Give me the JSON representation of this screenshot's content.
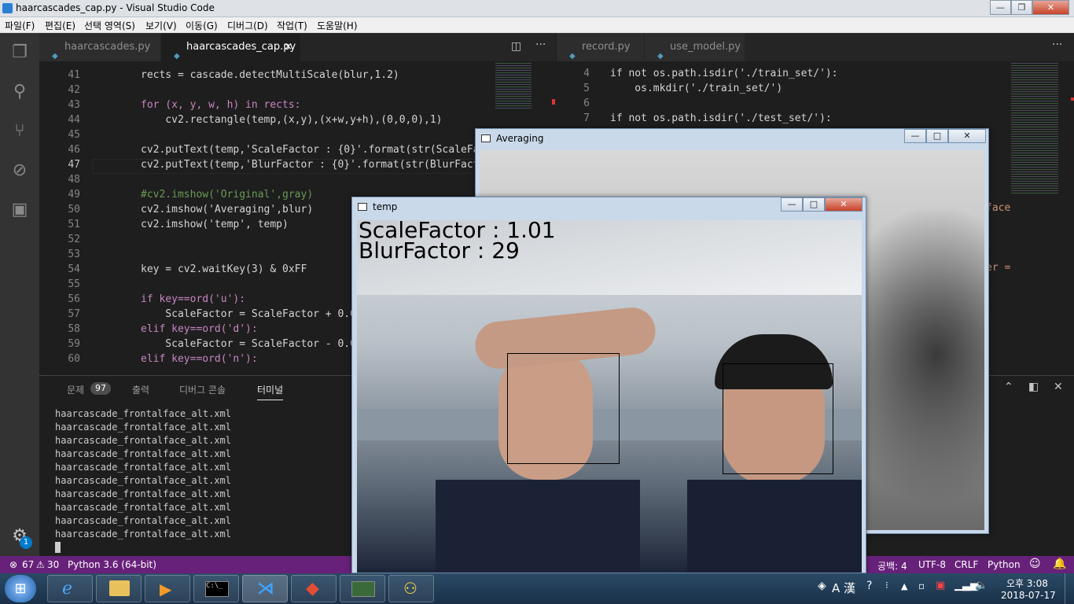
{
  "window": {
    "title": "haarcascades_cap.py - Visual Studio Code"
  },
  "menu": [
    "파일(F)",
    "편집(E)",
    "선택 영역(S)",
    "보기(V)",
    "이동(G)",
    "디버그(D)",
    "작업(T)",
    "도움말(H)"
  ],
  "tabs_left": [
    {
      "label": "haarcascades.py"
    },
    {
      "label": "haarcascades_cap.py",
      "close": "×"
    }
  ],
  "tabs_right": [
    {
      "label": "record.py"
    },
    {
      "label": "use_model.py"
    }
  ],
  "editor_left": {
    "line_numbers": [
      "41",
      "42",
      "43",
      "44",
      "45",
      "46",
      "47",
      "48",
      "49",
      "50",
      "51",
      "52",
      "53",
      "54",
      "55",
      "56",
      "57",
      "58",
      "59",
      "60"
    ],
    "lines": [
      "rects = cascade.detectMultiScale(blur,1.2)",
      "",
      "for (x, y, w, h) in rects:",
      "    cv2.rectangle(temp,(x,y),(x+w,y+h),(0,0,0),1)",
      "",
      "cv2.putText(temp,'ScaleFactor : {0}'.format(str(ScaleFa",
      "cv2.putText(temp,'BlurFactor : {0}'.format(str(BlurFact",
      "",
      "#cv2.imshow('Original',gray)",
      "cv2.imshow('Averaging',blur)",
      "cv2.imshow('temp', temp)",
      "",
      "",
      "key = cv2.waitKey(3) & 0xFF",
      "",
      "if key==ord('u'):",
      "    ScaleFactor = ScaleFactor + 0.0",
      "elif key==ord('d'):",
      "    ScaleFactor = ScaleFactor - 0.0",
      "elif key==ord('n'):"
    ]
  },
  "editor_right": {
    "line_numbers": [
      "4",
      "5",
      "6",
      "7"
    ],
    "lines": [
      "if not os.path.isdir('./train_set/'):",
      "    os.mkdir('./train_set/')",
      "",
      "if not os.path.isdir('./test_set/'):"
    ],
    "fragments": [
      "face",
      "er ="
    ]
  },
  "panel": {
    "tabs": [
      {
        "label": "문제",
        "badge": "97"
      },
      {
        "label": "출력"
      },
      {
        "label": "디버그 콘솔"
      },
      {
        "label": "터미널"
      }
    ],
    "terminal_lines": [
      "haarcascade_frontalface_alt.xml",
      "haarcascade_frontalface_alt.xml",
      "haarcascade_frontalface_alt.xml",
      "haarcascade_frontalface_alt.xml",
      "haarcascade_frontalface_alt.xml",
      "haarcascade_frontalface_alt.xml",
      "haarcascade_frontalface_alt.xml",
      "haarcascade_frontalface_alt.xml",
      "haarcascade_frontalface_alt.xml",
      "haarcascade_frontalface_alt.xml"
    ]
  },
  "status": {
    "errors": "67",
    "warnings": "30",
    "python": "Python 3.6 (64-bit)",
    "spaces": "공백: 4",
    "encoding": "UTF-8",
    "eol": "CRLF",
    "language": "Python",
    "gear_badge": "1"
  },
  "averaging_window": {
    "title": "Averaging"
  },
  "temp_window": {
    "title": "temp",
    "overlay_line1": "ScaleFactor : 1.01",
    "overlay_line2": "BlurFactor : 29"
  },
  "taskbar": {
    "ime": "A 漢",
    "time": "오후 3:08",
    "date": "2018-07-17"
  }
}
